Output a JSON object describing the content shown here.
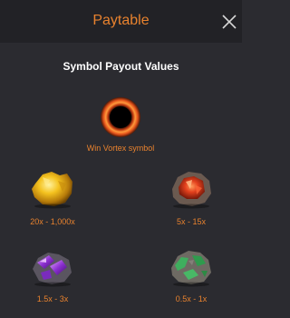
{
  "header": {
    "title": "Paytable",
    "close_icon": "close-icon"
  },
  "section": {
    "title": "Symbol Payout Values"
  },
  "vortex": {
    "label": "Win Vortex symbol",
    "icon": "vortex-icon"
  },
  "symbols": [
    {
      "name": "gold-nugget-icon",
      "payout": "20x - 1,000x"
    },
    {
      "name": "red-crystal-rock-icon",
      "payout": "5x - 15x"
    },
    {
      "name": "purple-crystal-rock-icon",
      "payout": "1.5x - 3x"
    },
    {
      "name": "green-mossy-rock-icon",
      "payout": "0.5x - 1x"
    }
  ],
  "colors": {
    "accent": "#e8822e",
    "background": "#2b2b30",
    "header_background": "#222226",
    "text": "#ffffff"
  }
}
